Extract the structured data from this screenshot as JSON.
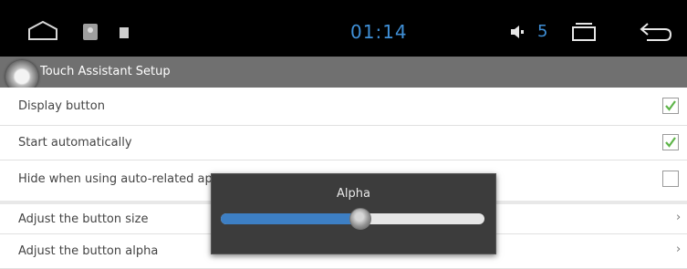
{
  "status_bar": {
    "time": "01:14",
    "volume": "5",
    "accent_color": "#3f8fd6",
    "icons": [
      "home-icon",
      "assistant-icon",
      "small-square-icon",
      "volume-icon",
      "recents-icon",
      "back-icon"
    ]
  },
  "title_bar": {
    "title": "Touch Assistant Setup"
  },
  "settings": {
    "display_button": {
      "label": "Display button",
      "checked": true
    },
    "start_automatically": {
      "label": "Start automatically",
      "checked": true
    },
    "hide_when_auto": {
      "label": "Hide when using auto-related applications",
      "checked": false
    },
    "adjust_size": {
      "label": "Adjust the button size"
    },
    "adjust_alpha": {
      "label": "Adjust the button alpha"
    }
  },
  "dialog": {
    "title": "Alpha",
    "slider_value": 0.53,
    "fill_color": "#3d7fc4"
  },
  "chevron": "›"
}
